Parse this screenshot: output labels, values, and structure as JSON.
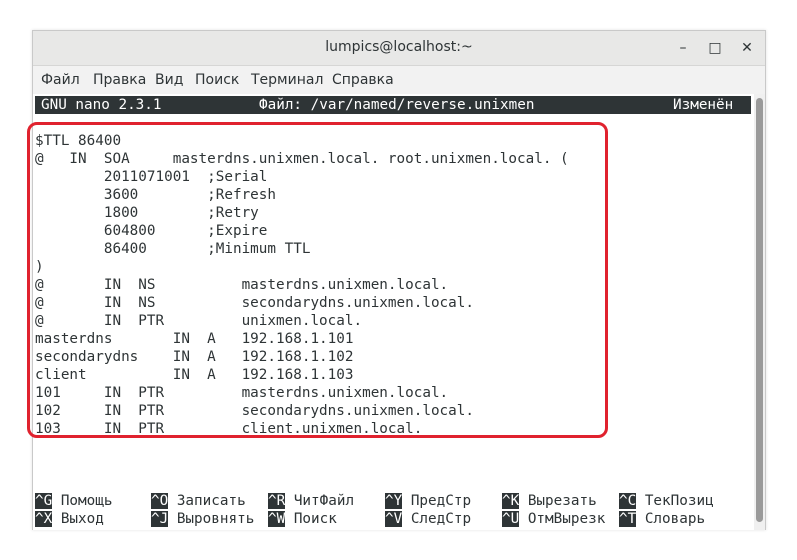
{
  "window": {
    "title": "lumpics@localhost:~",
    "minimize_glyph": "–",
    "maximize_glyph": "□",
    "close_glyph": "✕"
  },
  "menu": [
    "Файл",
    "Правка",
    "Вид",
    "Поиск",
    "Терминал",
    "Справка"
  ],
  "nano": {
    "version": "GNU nano 2.3.1",
    "file": "Файл: /var/named/reverse.unixmen",
    "status": "Изменён"
  },
  "file_lines": [
    "$TTL 86400",
    "@   IN  SOA     masterdns.unixmen.local. root.unixmen.local. (",
    "        2011071001  ;Serial",
    "        3600        ;Refresh",
    "        1800        ;Retry",
    "        604800      ;Expire",
    "        86400       ;Minimum TTL",
    ")",
    "@       IN  NS          masterdns.unixmen.local.",
    "@       IN  NS          secondarydns.unixmen.local.",
    "@       IN  PTR         unixmen.local.",
    "masterdns       IN  A   192.168.1.101",
    "secondarydns    IN  A   192.168.1.102",
    "client          IN  A   192.168.1.103",
    "101     IN  PTR         masterdns.unixmen.local.",
    "102     IN  PTR         secondarydns.unixmen.local.",
    "103     IN  PTR         client.unixmen.local."
  ],
  "shortcuts": [
    [
      {
        "key": "^G",
        "label": "Помощь"
      },
      {
        "key": "^O",
        "label": "Записать"
      },
      {
        "key": "^R",
        "label": "ЧитФайл"
      },
      {
        "key": "^Y",
        "label": "ПредСтр"
      },
      {
        "key": "^K",
        "label": "Вырезать"
      },
      {
        "key": "^C",
        "label": "ТекПозиц"
      }
    ],
    [
      {
        "key": "^X",
        "label": "Выход"
      },
      {
        "key": "^J",
        "label": "Выровнять"
      },
      {
        "key": "^W",
        "label": "Поиск"
      },
      {
        "key": "^V",
        "label": "СледСтр"
      },
      {
        "key": "^U",
        "label": "ОтмВырезк"
      },
      {
        "key": "^T",
        "label": "Словарь"
      }
    ]
  ],
  "colors": {
    "highlight": "#e0222e",
    "terminal_fg": "#2e3436",
    "terminal_bg": "#ffffff"
  }
}
